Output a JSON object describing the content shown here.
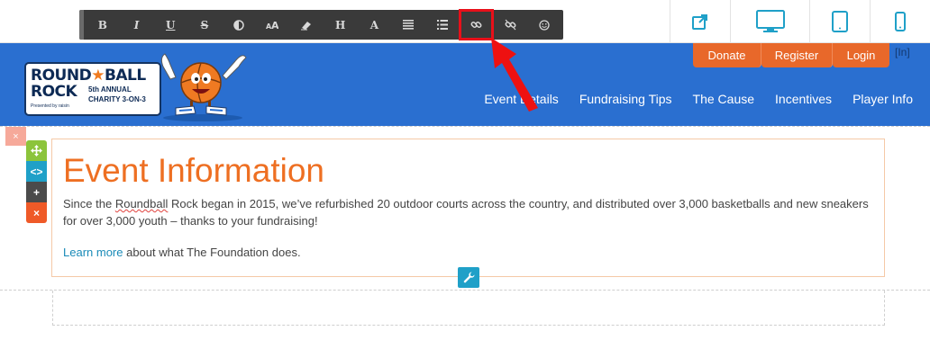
{
  "toolbar": {
    "buttons": [
      {
        "name": "bold",
        "glyph": "B"
      },
      {
        "name": "italic",
        "glyph": "I"
      },
      {
        "name": "underline",
        "glyph": "U"
      },
      {
        "name": "strikethrough",
        "glyph": "S"
      },
      {
        "name": "contrast",
        "glyph": "◐"
      },
      {
        "name": "font-size",
        "glyph": "ᴬA"
      },
      {
        "name": "eraser",
        "glyph": "⌫"
      },
      {
        "name": "heading",
        "glyph": "H"
      },
      {
        "name": "font",
        "glyph": "A"
      },
      {
        "name": "align",
        "glyph": "≡"
      },
      {
        "name": "list",
        "glyph": "☰"
      },
      {
        "name": "link",
        "glyph": "🔗",
        "highlighted": true
      },
      {
        "name": "unlink",
        "glyph": "⛓"
      },
      {
        "name": "emoji",
        "glyph": "☺"
      }
    ],
    "highlight_color": "#e8101a"
  },
  "devices": [
    {
      "name": "external-link",
      "icon": "external-link-icon"
    },
    {
      "name": "desktop",
      "icon": "desktop-icon",
      "active": true
    },
    {
      "name": "tablet",
      "icon": "tablet-icon"
    },
    {
      "name": "phone",
      "icon": "phone-icon"
    }
  ],
  "logo": {
    "line1_a": "ROUND",
    "star": "★",
    "line1_b": "BALL",
    "line2": "ROCK",
    "sub1": "5th ANNUAL",
    "sub2": "CHARITY 3-ON-3",
    "presented": "Presented by raisin"
  },
  "auth": {
    "donate": "Donate",
    "register": "Register",
    "login": "Login",
    "in_label": "[In]"
  },
  "nav": {
    "items": [
      "Event Details",
      "Fundraising Tips",
      "The Cause",
      "Incentives",
      "Player Info"
    ]
  },
  "editor": {
    "close_glyph": "×",
    "tools": {
      "move": "✥",
      "code": "<>",
      "add": "+",
      "delete": "×"
    }
  },
  "content": {
    "heading": "Event Information",
    "para_a": "Since the ",
    "para_sq": "Roundball",
    "para_b": " Rock began in 2015, we’ve refurbished 20 outdoor courts across the country, and distributed over 3,000 basketballs and new sneakers for over 3,000 youth – thanks to your fundraising!",
    "link_text": "Learn more",
    "after_link": " about what The Foundation does."
  },
  "colors": {
    "header_blue": "#2a6fd0",
    "accent_orange": "#e8682a",
    "heading_orange": "#ee6f22",
    "link_blue": "#1a8bb8"
  }
}
